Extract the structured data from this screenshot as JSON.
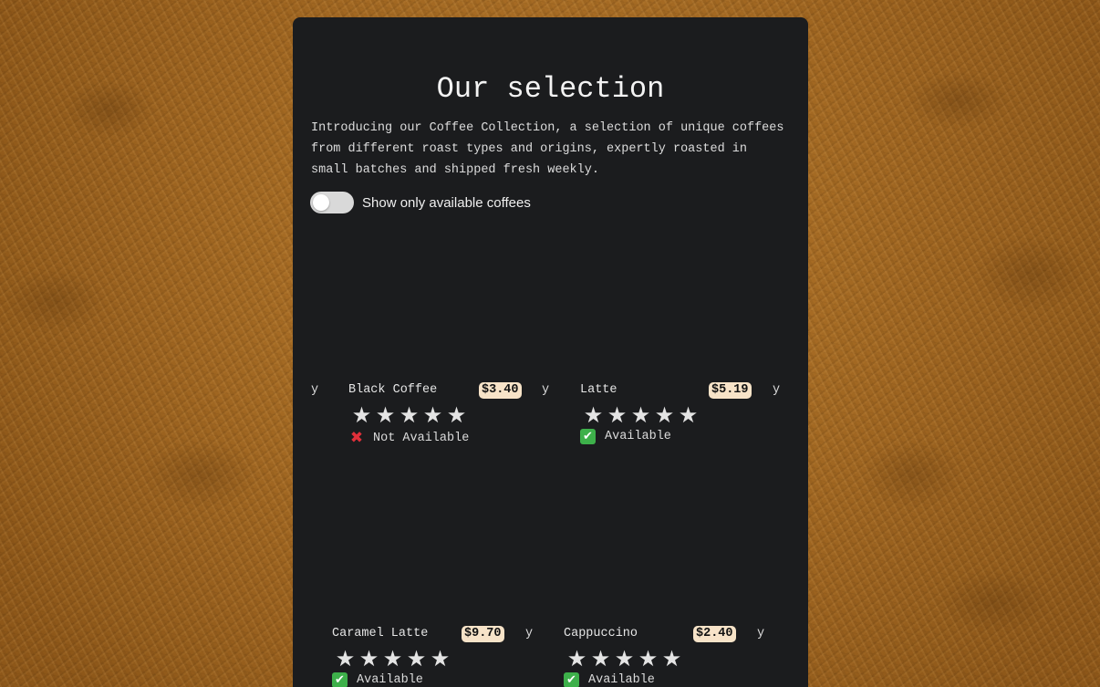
{
  "colors": {
    "background": "#a86b22",
    "card": "#1b1c1e",
    "price_badge": "#f7e3c8",
    "available_check": "#3db04a",
    "unavailable_x": "#e0303a"
  },
  "header": {
    "title": "Our selection",
    "intro": "Introducing our Coffee Collection, a selection of unique coffees from different roast types and origins, expertly roasted in small batches and shipped fresh weekly."
  },
  "filter": {
    "label": "Show only available coffees",
    "enabled": false
  },
  "stray_char": "y",
  "star_glyph": "★",
  "products": [
    {
      "name": "Black Coffee",
      "price": "$3.40",
      "rating": 5,
      "status": "Not Available",
      "available": false
    },
    {
      "name": "Latte",
      "price": "$5.19",
      "rating": 5,
      "status": "Available",
      "available": true
    },
    {
      "name": "Caramel Latte",
      "price": "$9.70",
      "rating": 5,
      "status": "Available",
      "available": true
    },
    {
      "name": "Cappuccino",
      "price": "$2.40",
      "rating": 5,
      "status": "Available",
      "available": true
    }
  ]
}
